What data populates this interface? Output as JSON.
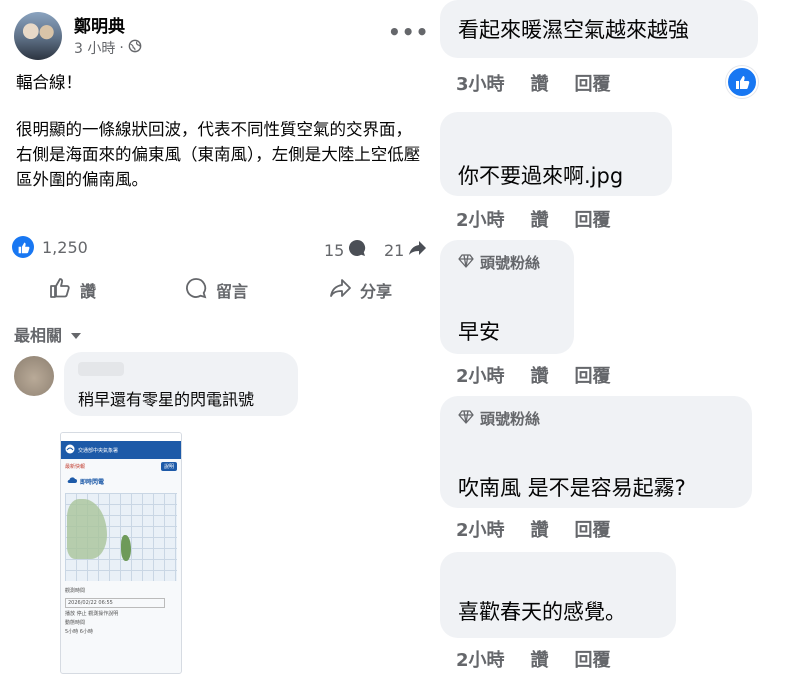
{
  "post": {
    "author": "鄭明典",
    "time": "3 小時",
    "separator": "·",
    "more": "•••",
    "headline": "輻合線！",
    "body": "很明顯的一條線狀回波，代表不同性質空氣的交界面，右側是海面來的偏東風（東南風），左側是大陸上空低壓區外圍的偏南風。",
    "like_count": "1,250",
    "comment_count": "15",
    "share_count": "21",
    "actions": {
      "like": "讚",
      "comment": "留言",
      "share": "分享"
    },
    "sort_label": "最相關"
  },
  "first_comment": {
    "text": "稍早還有零星的閃電訊號",
    "screenshot": {
      "title": "即時閃電",
      "tab_left": "最新快報",
      "tab_right": "說明",
      "agency": "交通部中央氣象署",
      "date_label": "觀測時間",
      "date_value": "2026/02/22 06:55",
      "play": "播放",
      "stop": "停止",
      "mode": "觀測操作說明",
      "interval_label": "動態時間",
      "opt1": "5小時",
      "opt2": "6小時"
    }
  },
  "right_comments": [
    {
      "text": "看起來暖濕空氣越來越強",
      "time": "3小時",
      "like": "讚",
      "reply": "回覆",
      "fan": null
    },
    {
      "text": "你不要過來啊.jpg",
      "time": "2小時",
      "like": "讚",
      "reply": "回覆",
      "fan": null
    },
    {
      "text": "早安",
      "time": "2小時",
      "like": "讚",
      "reply": "回覆",
      "fan": "頭號粉絲"
    },
    {
      "text": "吹南風 是不是容易起霧?",
      "time": "2小時",
      "like": "讚",
      "reply": "回覆",
      "fan": "頭號粉絲"
    },
    {
      "text": "喜歡春天的感覺。",
      "time": "2小時",
      "like": "讚",
      "reply": "回覆",
      "fan": null
    }
  ],
  "colors": {
    "facebook_blue": "#1877f2",
    "secondary_text": "#65676b",
    "bubble": "#f0f2f5"
  },
  "icons": [
    "globe-icon",
    "like-icon",
    "comment-icon",
    "share-icon",
    "more-icon",
    "chevron-down-icon",
    "diamond-icon"
  ]
}
